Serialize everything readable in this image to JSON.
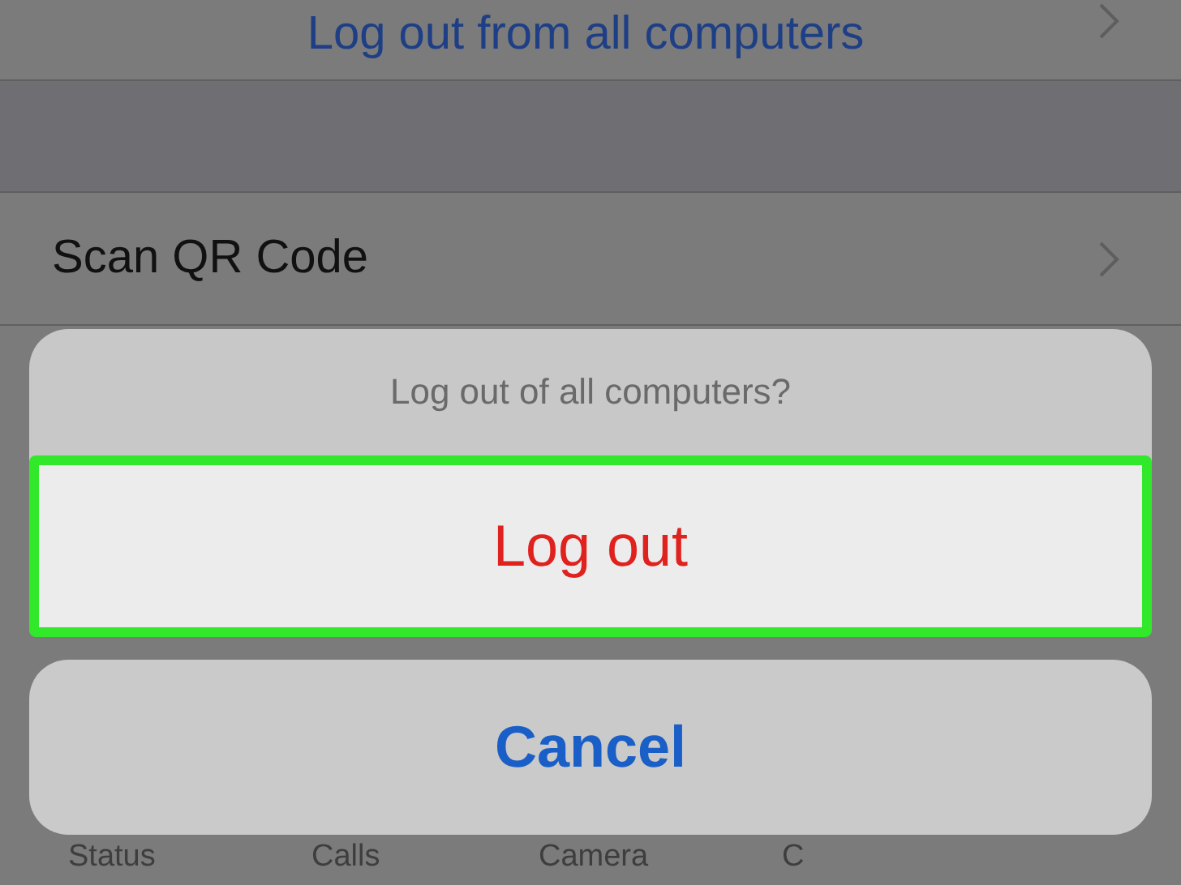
{
  "settings_rows": [
    {
      "label": "Log out from all computers",
      "kind": "link"
    },
    {
      "label": "Scan QR Code",
      "kind": "plain"
    }
  ],
  "tab_bar": [
    "Status",
    "Calls",
    "Camera",
    "C"
  ],
  "action_sheet": {
    "title": "Log out of all computers?",
    "actions": [
      {
        "label": "Log out",
        "kind": "destructive",
        "highlighted": true
      }
    ],
    "cancel": "Cancel"
  }
}
